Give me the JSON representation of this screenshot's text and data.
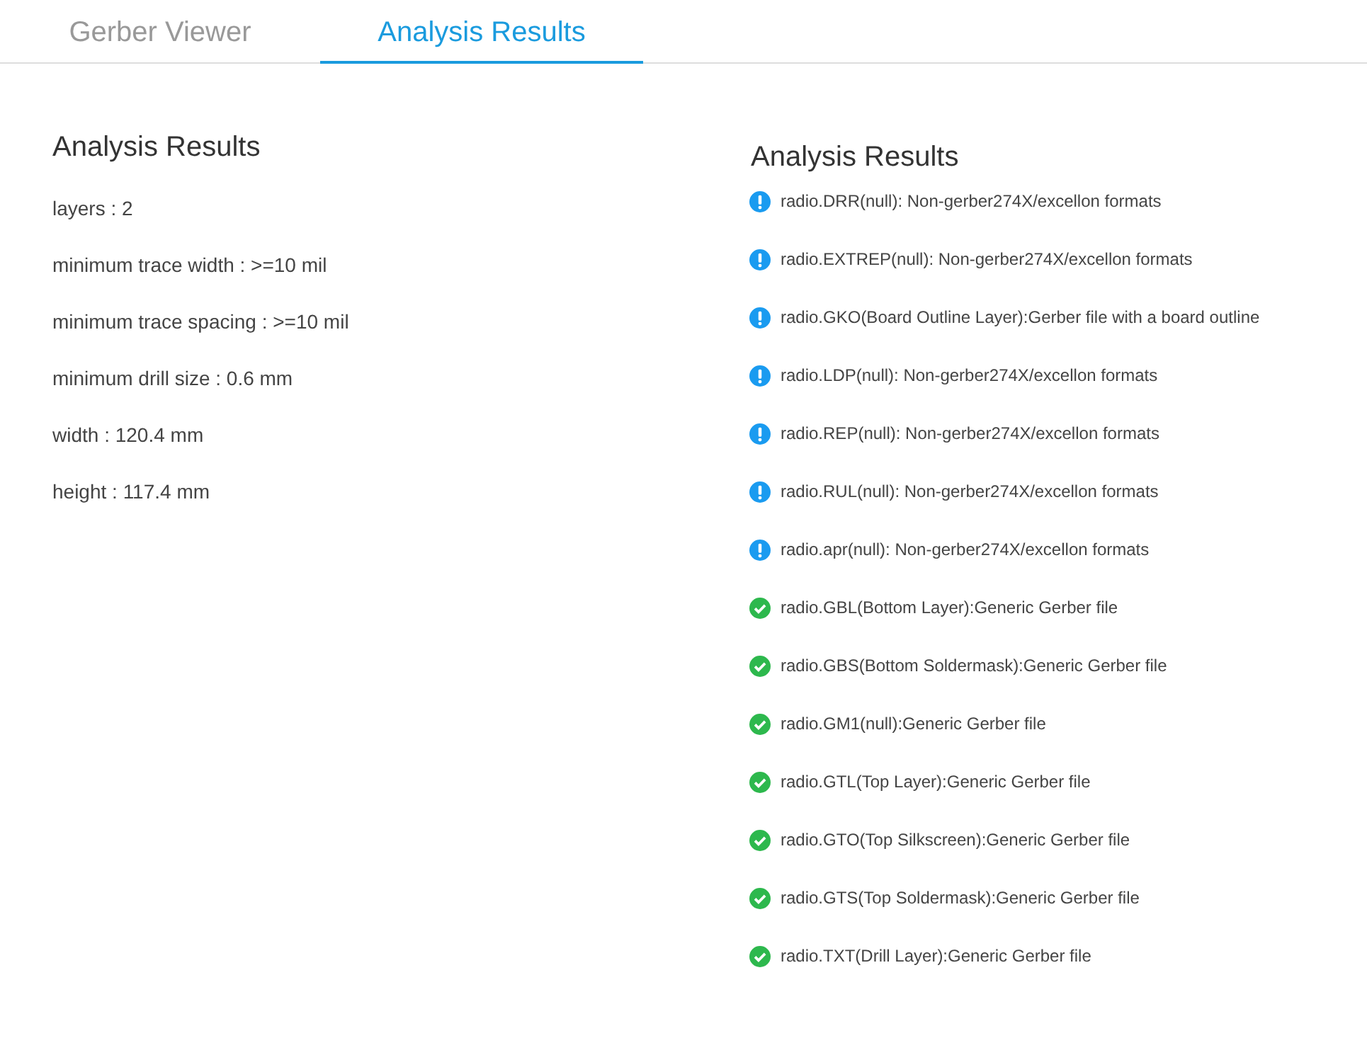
{
  "tabs": [
    {
      "label": "Gerber Viewer",
      "selected": false
    },
    {
      "label": "Analysis Results",
      "selected": true
    }
  ],
  "summary": {
    "title": "Analysis Results",
    "items": [
      "layers : 2",
      "minimum trace width : >=10 mil",
      "minimum trace spacing : >=10 mil",
      "minimum drill size : 0.6 mm",
      "width : 120.4 mm",
      "height : 117.4 mm"
    ]
  },
  "results": {
    "title": "Analysis Results",
    "items": [
      {
        "kind": "info",
        "text": "radio.DRR(null): Non-gerber274X/excellon formats"
      },
      {
        "kind": "info",
        "text": "radio.EXTREP(null): Non-gerber274X/excellon formats"
      },
      {
        "kind": "info",
        "text": "radio.GKO(Board Outline Layer):Gerber file with a board outline"
      },
      {
        "kind": "info",
        "text": "radio.LDP(null): Non-gerber274X/excellon formats"
      },
      {
        "kind": "info",
        "text": "radio.REP(null): Non-gerber274X/excellon formats"
      },
      {
        "kind": "info",
        "text": "radio.RUL(null): Non-gerber274X/excellon formats"
      },
      {
        "kind": "info",
        "text": "radio.apr(null): Non-gerber274X/excellon formats"
      },
      {
        "kind": "ok",
        "text": "radio.GBL(Bottom Layer):Generic Gerber file"
      },
      {
        "kind": "ok",
        "text": "radio.GBS(Bottom Soldermask):Generic Gerber file"
      },
      {
        "kind": "ok",
        "text": "radio.GM1(null):Generic Gerber file"
      },
      {
        "kind": "ok",
        "text": "radio.GTL(Top Layer):Generic Gerber file"
      },
      {
        "kind": "ok",
        "text": "radio.GTO(Top Silkscreen):Generic Gerber file"
      },
      {
        "kind": "ok",
        "text": "radio.GTS(Top Soldermask):Generic Gerber file"
      },
      {
        "kind": "ok",
        "text": "radio.TXT(Drill Layer):Generic Gerber file"
      }
    ]
  }
}
